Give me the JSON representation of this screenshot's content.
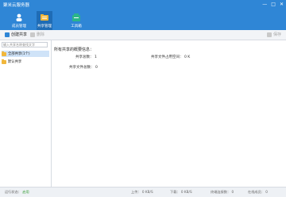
{
  "app": {
    "title": "聚米云服务器"
  },
  "window_buttons": [
    "—",
    "□",
    "✕"
  ],
  "toolbar": {
    "items": [
      {
        "label": "成员管理"
      },
      {
        "label": "共享管理"
      },
      {
        "label": "工具箱"
      }
    ]
  },
  "subbar": {
    "create_label": "创建共享",
    "delete_label": "删除",
    "save_label": "保存"
  },
  "sidebar": {
    "search_placeholder": "输入共享名称查找文字",
    "items": [
      {
        "label": "全部共享(1个)"
      },
      {
        "label": "默认共享"
      }
    ]
  },
  "main": {
    "summary_title": "所有共享的概要信息：",
    "share_count_label": "共享总数：",
    "share_count_value": "1",
    "space_used_label": "共享文件占用空间：",
    "space_used_value": "0 K",
    "file_count_label": "共享文件总数：",
    "file_count_value": "0"
  },
  "status": {
    "running_label": "运行状态：",
    "running_value": "启用",
    "upload_label": "上传：",
    "upload_value": "0 KB/S",
    "download_label": "下载：",
    "download_value": "0 KB/S",
    "connections_label": "终端连接数：",
    "connections_value": "0",
    "online_label": "在线成员：",
    "online_value": "0"
  },
  "colors": {
    "accent": "#2f86d6",
    "folder": "#f1b73b",
    "ok": "#2e9a2e"
  }
}
